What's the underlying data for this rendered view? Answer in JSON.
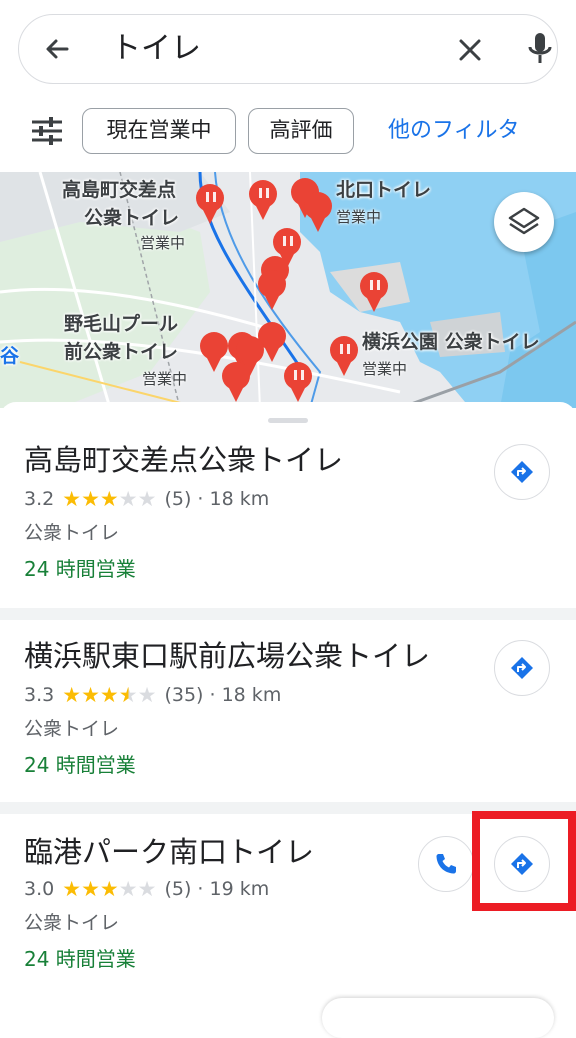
{
  "search": {
    "query": "トイレ"
  },
  "filters": {
    "chips": [
      "現在営業中",
      "高評価"
    ],
    "more": "他のフィルタ"
  },
  "map": {
    "labels": [
      {
        "name": "高島町交差点",
        "line2": "公衆トイレ",
        "status": "営業中"
      },
      {
        "name": "北口トイレ",
        "status": "営業中"
      },
      {
        "name": "野毛山プール",
        "line2": "前公衆トイレ",
        "status": "営業中"
      },
      {
        "name": "横浜公園 公衆トイレ",
        "status": "営業中"
      },
      {
        "name": "谷"
      }
    ]
  },
  "results": [
    {
      "title": "高島町交差点公衆トイレ",
      "rating": "3.2",
      "stars": 3.2,
      "reviews": "(5)",
      "distance": "· 18 km",
      "category": "公衆トイレ",
      "hours": "24 時間営業"
    },
    {
      "title": "横浜駅東口駅前広場公衆トイレ",
      "rating": "3.3",
      "stars": 3.3,
      "reviews": "(35)",
      "distance": "· 18 km",
      "category": "公衆トイレ",
      "hours": "24 時間営業"
    },
    {
      "title": "臨港パーク南口トイレ",
      "rating": "3.0",
      "stars": 3.0,
      "reviews": "(5)",
      "distance": "· 19 km",
      "category": "公衆トイレ",
      "hours": "24 時間営業"
    }
  ],
  "colors": {
    "accent": "#1a73e8",
    "open": "#188038",
    "star": "#fbbc04",
    "pin": "#ea4335",
    "highlight": "#ec1c24"
  }
}
